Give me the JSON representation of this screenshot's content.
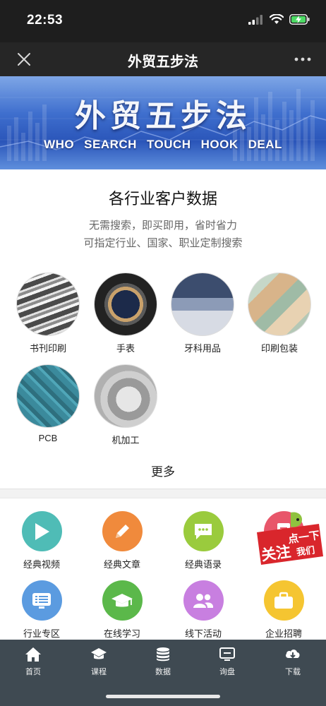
{
  "status_bar": {
    "time": "22:53"
  },
  "nav": {
    "title": "外贸五步法"
  },
  "banner": {
    "title": "外贸五步法",
    "steps": [
      "WHO",
      "SEARCH",
      "TOUCH",
      "HOOK",
      "DEAL"
    ]
  },
  "industry_section": {
    "title": "各行业客户数据",
    "subtitle_line1": "无需搜索，即买即用，省时省力",
    "subtitle_line2": "可指定行业、国家、职业定制搜索",
    "items": [
      {
        "label": "书刊印刷"
      },
      {
        "label": "手表"
      },
      {
        "label": "牙科用品"
      },
      {
        "label": "印刷包装"
      },
      {
        "label": "PCB"
      },
      {
        "label": "机加工"
      }
    ],
    "more_label": "更多"
  },
  "features": {
    "items": [
      {
        "label": "经典视频",
        "icon": "play-icon",
        "color": "#4fbcb6"
      },
      {
        "label": "经典文章",
        "icon": "pencil-icon",
        "color": "#f08a3c"
      },
      {
        "label": "经典语录",
        "icon": "chat-bubble-icon",
        "color": "#9acb3d"
      },
      {
        "label": "",
        "icon": "document-icon",
        "color": "#e8566a"
      },
      {
        "label": "行业专区",
        "icon": "list-screen-icon",
        "color": "#5b9be0"
      },
      {
        "label": "在线学习",
        "icon": "graduation-cap-icon",
        "color": "#5bb84a"
      },
      {
        "label": "线下活动",
        "icon": "people-icon",
        "color": "#c87fe0"
      },
      {
        "label": "企业招聘",
        "icon": "briefcase-icon",
        "color": "#f5c531"
      }
    ]
  },
  "follow_badge": {
    "line1": "点一下",
    "line2": "关注",
    "line3": "我们"
  },
  "tab_bar": {
    "items": [
      {
        "label": "首页",
        "icon": "home-icon"
      },
      {
        "label": "课程",
        "icon": "graduation-cap-icon"
      },
      {
        "label": "数据",
        "icon": "database-icon"
      },
      {
        "label": "询盘",
        "icon": "monitor-icon"
      },
      {
        "label": "下载",
        "icon": "cloud-download-icon"
      }
    ]
  },
  "colors": {
    "nav_bg": "#262626",
    "tab_bar_bg": "#3f4a52",
    "banner_blue": "#2a55b9",
    "badge_red": "#d9262c"
  }
}
